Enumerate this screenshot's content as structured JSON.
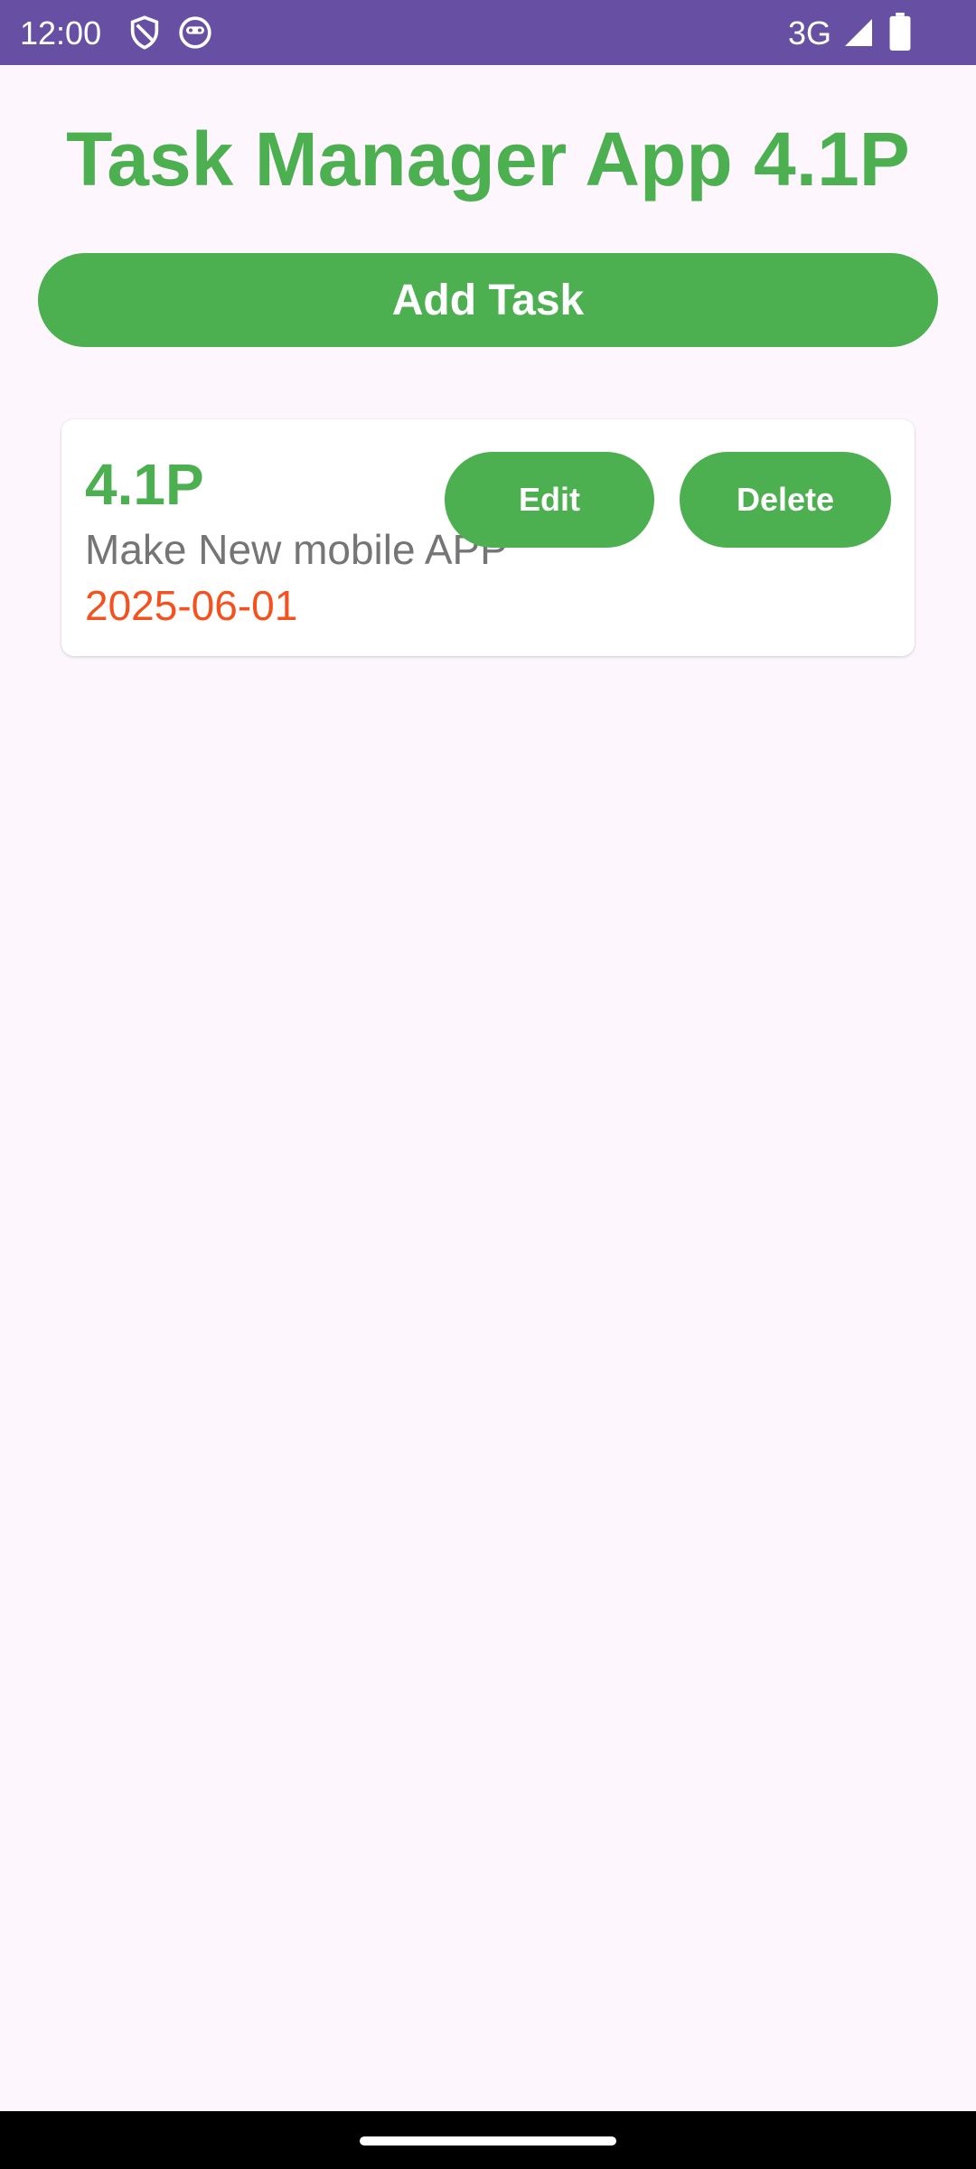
{
  "status_bar": {
    "time": "12:00",
    "network": "3G",
    "icons": [
      "shield-icon",
      "face-icon",
      "signal-icon",
      "battery-icon"
    ]
  },
  "app": {
    "title": "Task Manager App 4.1P",
    "add_task_label": "Add Task",
    "accent_color": "#4caf50",
    "status_bar_color": "#6750a4"
  },
  "tasks": [
    {
      "title": "4.1P",
      "description": "Make New mobile APP",
      "due_date": "2025-06-01",
      "edit_label": "Edit",
      "delete_label": "Delete"
    }
  ]
}
